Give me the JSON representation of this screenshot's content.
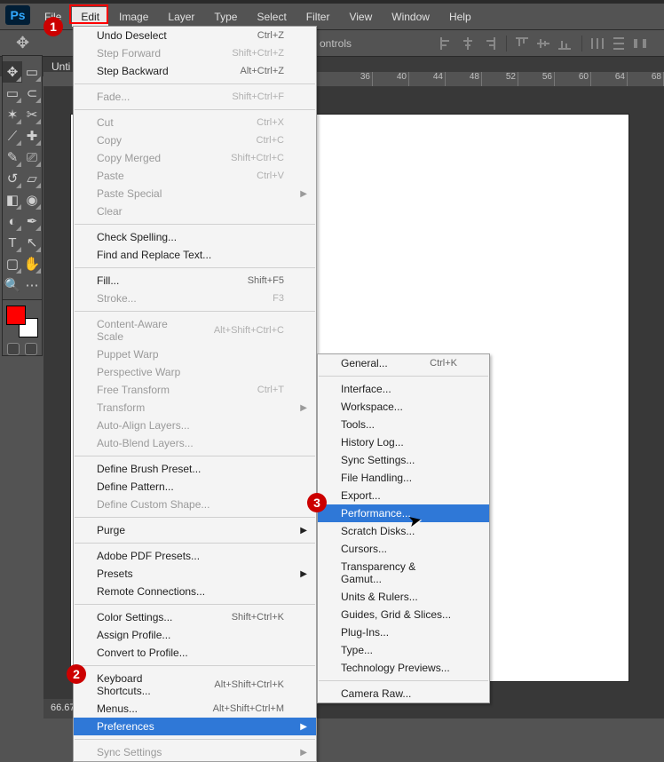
{
  "app_logo": "Ps",
  "menubar": [
    "File",
    "Edit",
    "Image",
    "Layer",
    "Type",
    "Select",
    "Filter",
    "View",
    "Window",
    "Help"
  ],
  "options_label": "ontrols",
  "doc_tab": "Unti",
  "ruler_values": [
    "36",
    "40",
    "44",
    "48",
    "52",
    "56",
    "60",
    "64",
    "68"
  ],
  "zoom": "66.67",
  "edit_menu": [
    {
      "label": "Undo Deselect",
      "shortcut": "Ctrl+Z"
    },
    {
      "label": "Step Forward",
      "shortcut": "Shift+Ctrl+Z",
      "disabled": true
    },
    {
      "label": "Step Backward",
      "shortcut": "Alt+Ctrl+Z"
    },
    {
      "sep": true
    },
    {
      "label": "Fade...",
      "shortcut": "Shift+Ctrl+F",
      "disabled": true
    },
    {
      "sep": true
    },
    {
      "label": "Cut",
      "shortcut": "Ctrl+X",
      "disabled": true
    },
    {
      "label": "Copy",
      "shortcut": "Ctrl+C",
      "disabled": true
    },
    {
      "label": "Copy Merged",
      "shortcut": "Shift+Ctrl+C",
      "disabled": true
    },
    {
      "label": "Paste",
      "shortcut": "Ctrl+V",
      "disabled": true
    },
    {
      "label": "Paste Special",
      "submenu": true,
      "disabled": true
    },
    {
      "label": "Clear",
      "disabled": true
    },
    {
      "sep": true
    },
    {
      "label": "Check Spelling..."
    },
    {
      "label": "Find and Replace Text..."
    },
    {
      "sep": true
    },
    {
      "label": "Fill...",
      "shortcut": "Shift+F5"
    },
    {
      "label": "Stroke...",
      "shortcut": "F3",
      "disabled": true
    },
    {
      "sep": true
    },
    {
      "label": "Content-Aware Scale",
      "shortcut": "Alt+Shift+Ctrl+C",
      "disabled": true
    },
    {
      "label": "Puppet Warp",
      "disabled": true
    },
    {
      "label": "Perspective Warp",
      "disabled": true
    },
    {
      "label": "Free Transform",
      "shortcut": "Ctrl+T",
      "disabled": true
    },
    {
      "label": "Transform",
      "submenu": true,
      "disabled": true
    },
    {
      "label": "Auto-Align Layers...",
      "disabled": true
    },
    {
      "label": "Auto-Blend Layers...",
      "disabled": true
    },
    {
      "sep": true
    },
    {
      "label": "Define Brush Preset..."
    },
    {
      "label": "Define Pattern..."
    },
    {
      "label": "Define Custom Shape...",
      "disabled": true
    },
    {
      "sep": true
    },
    {
      "label": "Purge",
      "submenu": true
    },
    {
      "sep": true
    },
    {
      "label": "Adobe PDF Presets..."
    },
    {
      "label": "Presets",
      "submenu": true
    },
    {
      "label": "Remote Connections..."
    },
    {
      "sep": true
    },
    {
      "label": "Color Settings...",
      "shortcut": "Shift+Ctrl+K"
    },
    {
      "label": "Assign Profile..."
    },
    {
      "label": "Convert to Profile..."
    },
    {
      "sep": true
    },
    {
      "label": "Keyboard Shortcuts...",
      "shortcut": "Alt+Shift+Ctrl+K"
    },
    {
      "label": "Menus...",
      "shortcut": "Alt+Shift+Ctrl+M"
    },
    {
      "label": "Preferences",
      "submenu": true,
      "highlight": true
    },
    {
      "sep": true
    },
    {
      "label": "Sync Settings",
      "submenu": true,
      "disabled": true
    }
  ],
  "prefs_submenu": [
    {
      "label": "General...",
      "shortcut": "Ctrl+K"
    },
    {
      "sep": true
    },
    {
      "label": "Interface..."
    },
    {
      "label": "Workspace..."
    },
    {
      "label": "Tools..."
    },
    {
      "label": "History Log..."
    },
    {
      "label": "Sync Settings..."
    },
    {
      "label": "File Handling..."
    },
    {
      "label": "Export..."
    },
    {
      "label": "Performance...",
      "highlight": true
    },
    {
      "label": "Scratch Disks..."
    },
    {
      "label": "Cursors..."
    },
    {
      "label": "Transparency & Gamut..."
    },
    {
      "label": "Units & Rulers..."
    },
    {
      "label": "Guides, Grid & Slices..."
    },
    {
      "label": "Plug-Ins..."
    },
    {
      "label": "Type..."
    },
    {
      "label": "Technology Previews..."
    },
    {
      "sep": true
    },
    {
      "label": "Camera Raw..."
    }
  ],
  "badges": {
    "one": "1",
    "two": "2",
    "three": "3"
  }
}
